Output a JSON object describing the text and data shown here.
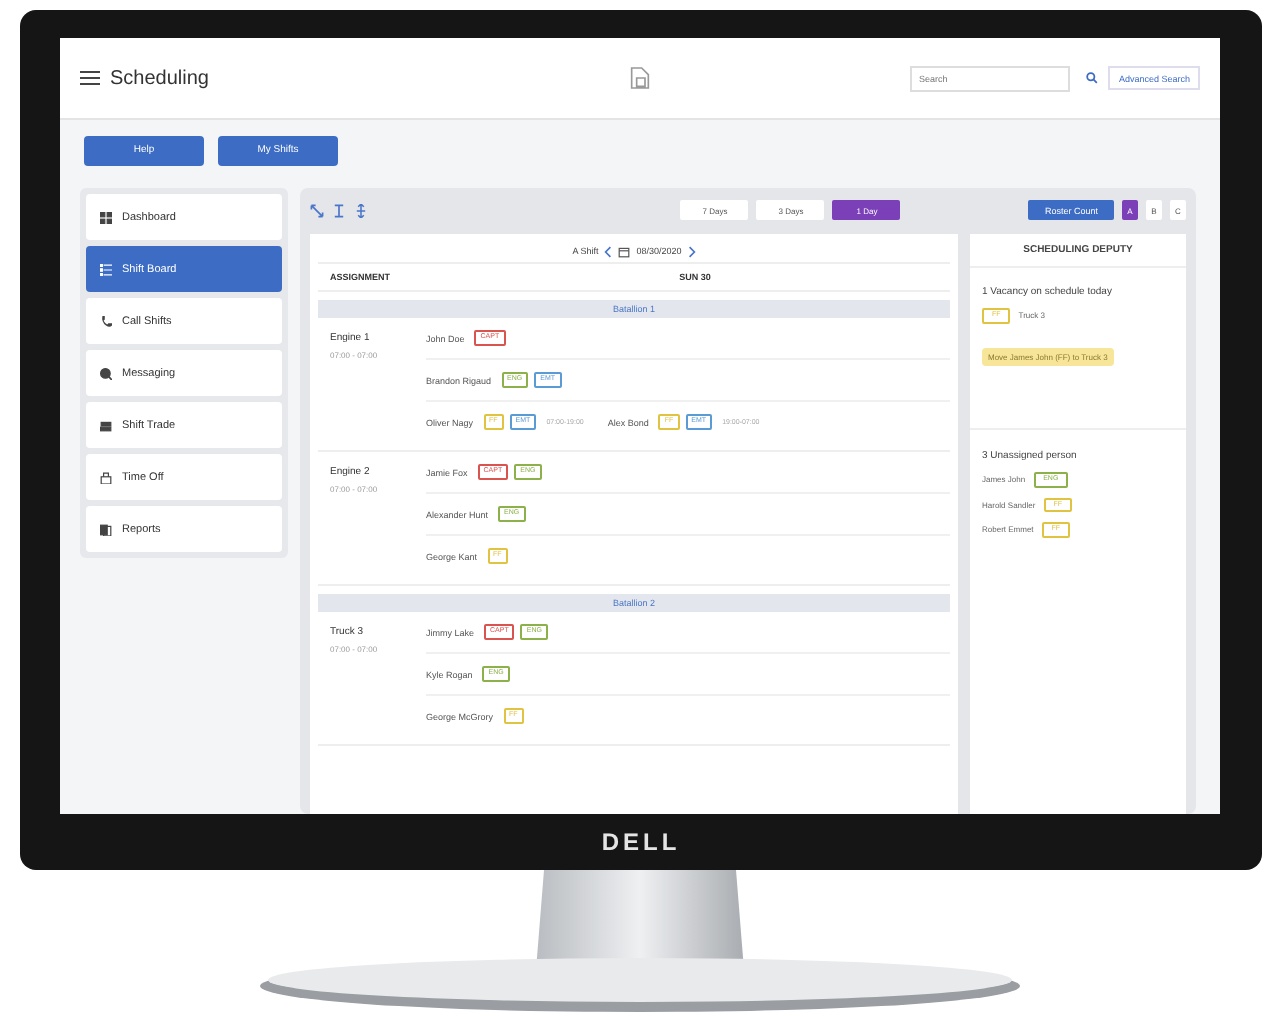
{
  "header": {
    "title": "Scheduling",
    "search": {
      "placeholder": "Search"
    },
    "advanced_search": "Advanced Search"
  },
  "top_buttons": [
    "Help",
    "My Shifts"
  ],
  "sidebar": {
    "items": [
      {
        "label": "Dashboard",
        "selected": false
      },
      {
        "label": "Shift Board",
        "selected": true
      },
      {
        "label": "Call Shifts",
        "selected": false
      },
      {
        "label": "Messaging",
        "selected": false
      },
      {
        "label": "Shift Trade",
        "selected": false
      },
      {
        "label": "Time Off",
        "selected": false
      },
      {
        "label": "Reports",
        "selected": false
      }
    ]
  },
  "view_tabs": [
    {
      "label": "7 Days",
      "selected": false
    },
    {
      "label": "3 Days",
      "selected": false
    },
    {
      "label": "1 Day",
      "selected": true
    }
  ],
  "roster_button": "Roster Count",
  "shift_tabs": [
    {
      "label": "A",
      "selected": true
    },
    {
      "label": "B",
      "selected": false
    },
    {
      "label": "C",
      "selected": false
    }
  ],
  "board": {
    "shift_label": "A Shift",
    "date": "08/30/2020",
    "columns": [
      "ASSIGNMENT",
      "SUN 30"
    ],
    "groups": [
      {
        "name": "Batallion 1",
        "units": [
          {
            "name": "Engine 1",
            "hours": "07:00 - 07:00",
            "rows": [
              {
                "people": [
                  {
                    "name": "John Doe",
                    "tags": [
                      {
                        "label": "CAPT",
                        "color": "#d9534f"
                      }
                    ]
                  }
                ]
              },
              {
                "people": [
                  {
                    "name": "Brandon Rigaud",
                    "tags": [
                      {
                        "label": "ENG",
                        "color": "#8cb04a"
                      },
                      {
                        "label": "EMT",
                        "color": "#5b9bd5"
                      }
                    ]
                  }
                ]
              },
              {
                "people": [
                  {
                    "name": "Oliver Nagy",
                    "tags": [
                      {
                        "label": "FF",
                        "color": "#e0c341"
                      },
                      {
                        "label": "EMT",
                        "color": "#5b9bd5"
                      }
                    ],
                    "time": "07:00-19:00"
                  },
                  {
                    "name": "Alex Bond",
                    "tags": [
                      {
                        "label": "FF",
                        "color": "#e0c341"
                      },
                      {
                        "label": "EMT",
                        "color": "#5b9bd5"
                      }
                    ],
                    "time": "19:00-07:00"
                  }
                ]
              }
            ]
          },
          {
            "name": "Engine 2",
            "hours": "07:00 - 07:00",
            "rows": [
              {
                "people": [
                  {
                    "name": "Jamie Fox",
                    "tags": [
                      {
                        "label": "CAPT",
                        "color": "#d9534f"
                      },
                      {
                        "label": "ENG",
                        "color": "#8cb04a"
                      }
                    ]
                  }
                ]
              },
              {
                "people": [
                  {
                    "name": "Alexander Hunt",
                    "tags": [
                      {
                        "label": "ENG",
                        "color": "#8cb04a"
                      }
                    ]
                  }
                ]
              },
              {
                "people": [
                  {
                    "name": "George Kant",
                    "tags": [
                      {
                        "label": "FF",
                        "color": "#e0c341"
                      }
                    ]
                  }
                ]
              }
            ]
          }
        ]
      },
      {
        "name": "Batallion 2",
        "units": [
          {
            "name": "Truck 3",
            "hours": "07:00 - 07:00",
            "rows": [
              {
                "people": [
                  {
                    "name": "Jimmy Lake",
                    "tags": [
                      {
                        "label": "CAPT",
                        "color": "#d9534f"
                      },
                      {
                        "label": "ENG",
                        "color": "#8cb04a"
                      }
                    ]
                  }
                ]
              },
              {
                "people": [
                  {
                    "name": "Kyle Rogan",
                    "tags": [
                      {
                        "label": "ENG",
                        "color": "#8cb04a"
                      }
                    ]
                  }
                ]
              },
              {
                "people": [
                  {
                    "name": "George McGrory",
                    "tags": [
                      {
                        "label": "FF",
                        "color": "#e0c341"
                      }
                    ]
                  }
                ]
              }
            ]
          }
        ]
      }
    ]
  },
  "deputy": {
    "title": "SCHEDULING DEPUTY",
    "vacancy_text": "1 Vacancy on schedule today",
    "vacancy_tag": {
      "label": "FF",
      "color": "#e0c341"
    },
    "vacancy_unit": "Truck 3",
    "suggestion": "Move James John (FF) to Truck 3",
    "unassigned_title": "3 Unassigned person",
    "unassigned": [
      {
        "name": "James John",
        "tags": [
          {
            "label": "ENG",
            "color": "#8cb04a"
          }
        ]
      },
      {
        "name": "Harold Sandler",
        "tags": [
          {
            "label": "FF",
            "color": "#e0c341"
          }
        ]
      },
      {
        "name": "Robert Emmet",
        "tags": [
          {
            "label": "FF",
            "color": "#e0c341"
          }
        ]
      }
    ]
  },
  "monitor": {
    "brand": "DELL"
  }
}
